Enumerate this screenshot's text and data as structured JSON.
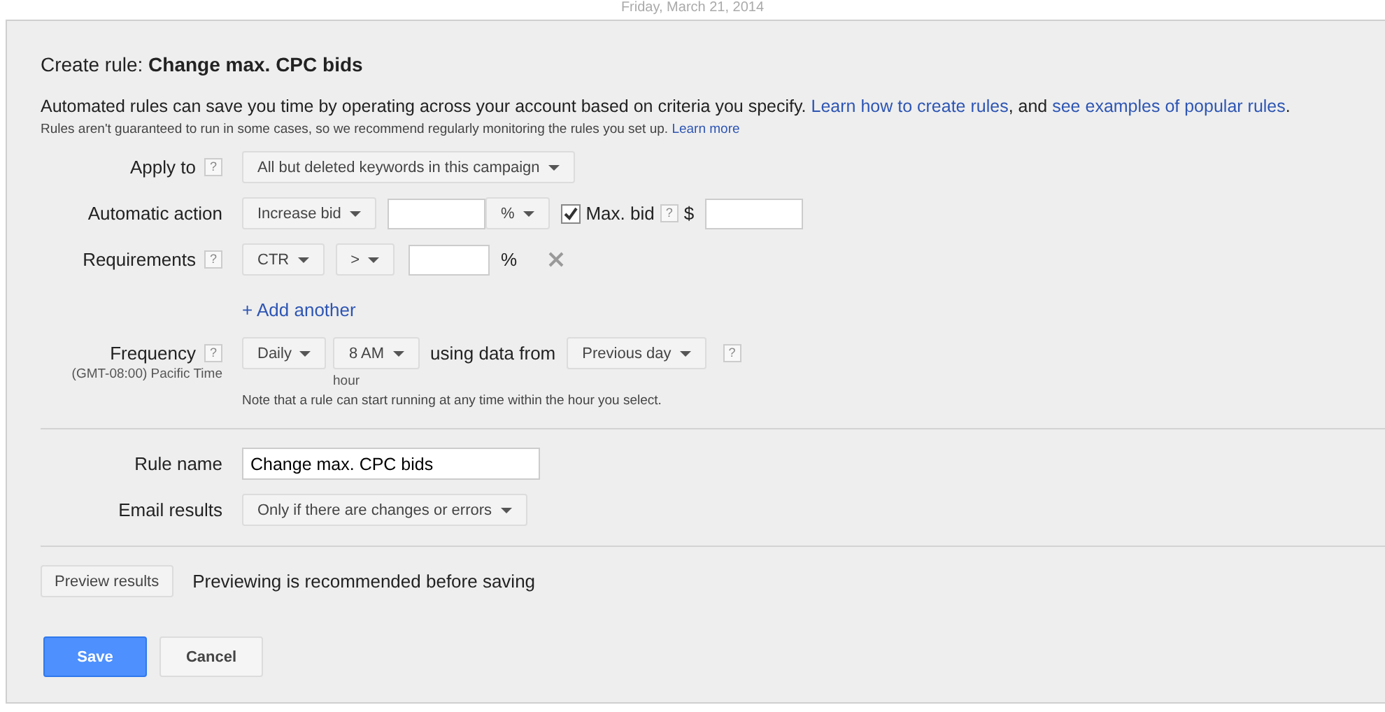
{
  "header_date": "Friday, March 21, 2014",
  "title": "Create rule: **Change max. CPC bids**",
  "description": [
    {
      "kind": "text",
      "text": "Automated rules can save you time by operating across your account based on criteria you specify. "
    },
    {
      "kind": "link",
      "text": "Learn how to create rules"
    },
    {
      "kind": "text",
      "text": ", and "
    },
    {
      "kind": "link",
      "text": "see examples of popular rules"
    },
    {
      "kind": "text",
      "text": "."
    }
  ],
  "note": {
    "text": "Rules aren't guaranteed to run in some cases, so we recommend regularly monitoring the rules you set up. ",
    "link": "Learn more"
  },
  "apply_to": {
    "label": "Apply to",
    "help": "?",
    "dropdown": "All but deleted keywords in this campaign"
  },
  "automatic_action": {
    "label": "Automatic action",
    "action": "Increase bid",
    "unit": "%",
    "max_bid": {
      "checked": true,
      "label": "Max. bid",
      "help": "?",
      "currency": "$"
    }
  },
  "requirements": {
    "label": "Requirements",
    "help": "?",
    "metric": "CTR",
    "operator": ">",
    "unit": "%"
  },
  "add_another": "+ Add another",
  "frequency": {
    "label": "Frequency",
    "help": "?",
    "timezone": "(GMT-08:00) Pacific Time",
    "schedule": "Daily",
    "hour": "8 AM",
    "hour_caption": "hour",
    "data_label": "using data from",
    "data_range": "Previous day",
    "range_help": "?",
    "note": "Note that a rule can start running at any time within the hour you select."
  },
  "rule_name": {
    "label": "Rule name",
    "value": "Change max. CPC bids"
  },
  "email_results": {
    "label": "Email results",
    "dropdown": "Only if there are changes or errors"
  },
  "preview": {
    "button": "Preview results",
    "note": "Previewing is recommended before saving"
  },
  "buttons": [
    {
      "kind": "primary",
      "label": "Save"
    },
    {
      "kind": "secondary",
      "label": "Cancel"
    }
  ]
}
